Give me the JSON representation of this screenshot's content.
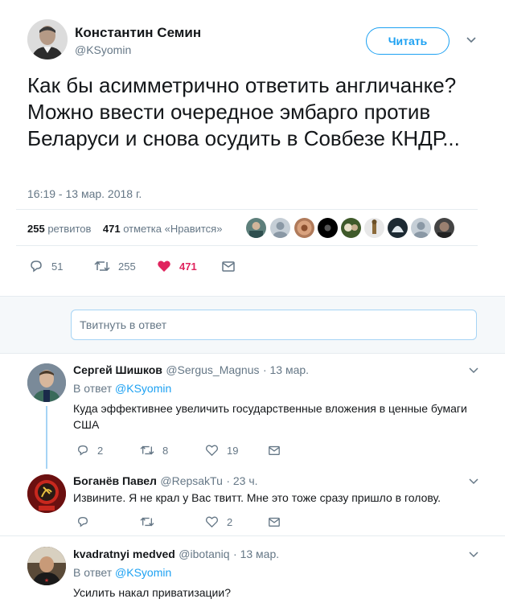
{
  "main_tweet": {
    "author_name": "Константин Семин",
    "author_handle": "@KSyomin",
    "follow_label": "Читать",
    "text": "Как бы асимметрично ответить англичанке? Можно ввести очередное эмбарго против Беларуси и снова осудить в Совбезе КНДР...",
    "timestamp": "16:19 - 13 мар. 2018 г.",
    "retweets_count": "255",
    "retweets_label": "ретвитов",
    "likes_count": "471",
    "likes_label": "отметка «Нравится»",
    "actions": {
      "replies": "51",
      "retweets": "255",
      "likes": "471"
    },
    "liked": true
  },
  "reply_box": {
    "placeholder": "Твитнуть в ответ"
  },
  "replies": [
    {
      "name": "Сергей Шишков",
      "handle": "@Sergus_Magnus",
      "time": "· 13 мар.",
      "reply_to_prefix": "В ответ",
      "reply_to_handle": "@KSyomin",
      "text": "Куда эффективнее увеличить государственные вложения в ценные бумаги США",
      "replies": "2",
      "retweets": "8",
      "likes": "19"
    },
    {
      "name": "Боганёв Павел",
      "handle": "@RepsakTu",
      "time": "· 23 ч.",
      "text": "Извините. Я не крал у Вас твитт. Мне это тоже сразу пришло в голову.",
      "replies": "",
      "retweets": "",
      "likes": "2"
    },
    {
      "name": "kvadratnyi medved",
      "handle": "@ibotaniq",
      "time": "· 13 мар.",
      "reply_to_prefix": "В ответ",
      "reply_to_handle": "@KSyomin",
      "text": "Усилить накал приватизации?"
    }
  ],
  "colors": {
    "accent": "#1da1f2",
    "like": "#e0245e",
    "muted": "#657786",
    "thread": "#a6d4f5"
  },
  "icons": [
    "reply-icon",
    "retweet-icon",
    "heart-icon",
    "envelope-icon",
    "chevron-down-icon"
  ]
}
